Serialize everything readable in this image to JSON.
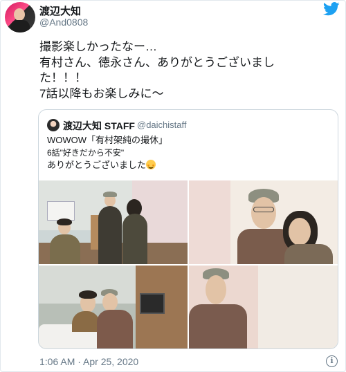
{
  "author": {
    "name": "渡辺大知",
    "handle": "@And0808"
  },
  "tweet": {
    "lines": [
      "撮影楽しかったなー…",
      "有村さん、徳永さん、ありがとうございまし",
      "た！！！",
      "7話以降もお楽しみに〜"
    ]
  },
  "quoted": {
    "name": "渡辺大知 STAFF",
    "handle": "@daichistaff",
    "line1": "WOWOW「有村架純の撮休」",
    "line2": "6話\"好きだから不安\"",
    "line3": "ありがとうございました"
  },
  "meta": {
    "timestamp": "1:06 AM · Apr 25, 2020",
    "info_glyph": "i"
  },
  "colors": {
    "twitter_blue": "#1da1f2",
    "secondary_text": "#657786",
    "border": "#ccd6dd"
  },
  "icons": [
    "twitter-bird-icon",
    "info-icon",
    "smiling-face-emoji"
  ]
}
